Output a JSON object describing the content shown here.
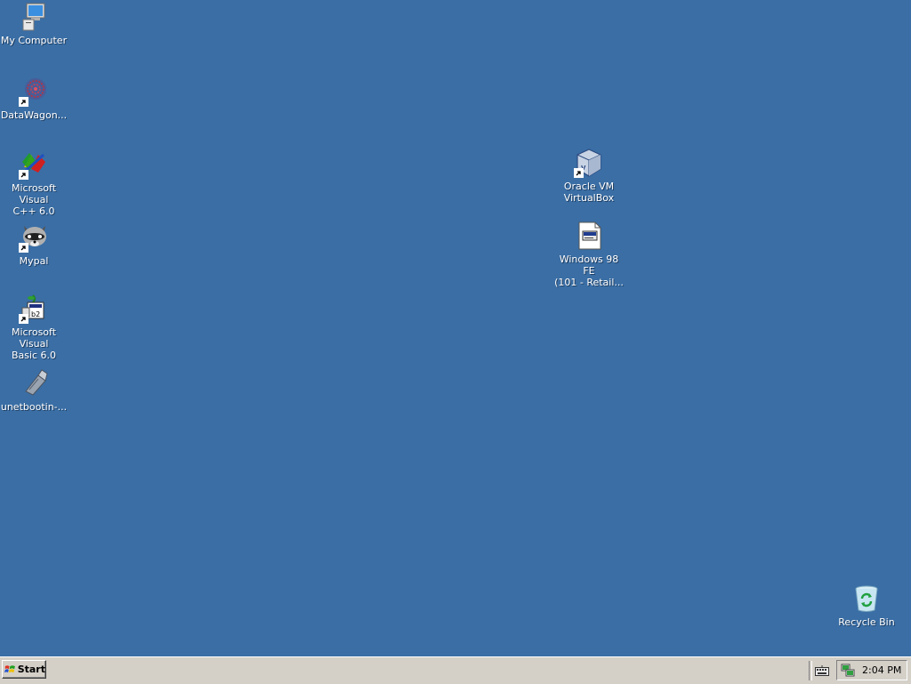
{
  "desktop": {
    "icons": [
      {
        "label": "My Computer",
        "icon": "computer-icon"
      },
      {
        "label": "DataWagon...",
        "icon": "datawagon-icon"
      },
      {
        "label_line1": "Microsoft Visual",
        "label_line2": "C++ 6.0",
        "icon": "visual-cpp-icon"
      },
      {
        "label": "Mypal",
        "icon": "raccoon-icon"
      },
      {
        "label_line1": "Microsoft Visual",
        "label_line2": "Basic 6.0",
        "icon": "visual-basic-icon"
      },
      {
        "label": "unetbootin-...",
        "icon": "usb-drive-icon"
      },
      {
        "label_line1": "Oracle VM",
        "label_line2": "VirtualBox",
        "icon": "virtualbox-icon"
      },
      {
        "label_line1": "Windows 98 FE",
        "label_line2": "(101 - Retail...",
        "icon": "disk-image-icon"
      },
      {
        "label": "Recycle Bin",
        "icon": "recycle-bin-icon"
      }
    ],
    "background_color": "#3a6ea5"
  },
  "taskbar": {
    "start_label": "Start",
    "clock": "2:04 PM",
    "tray_icons": [
      "keyboard-icon",
      "network-icon"
    ]
  }
}
